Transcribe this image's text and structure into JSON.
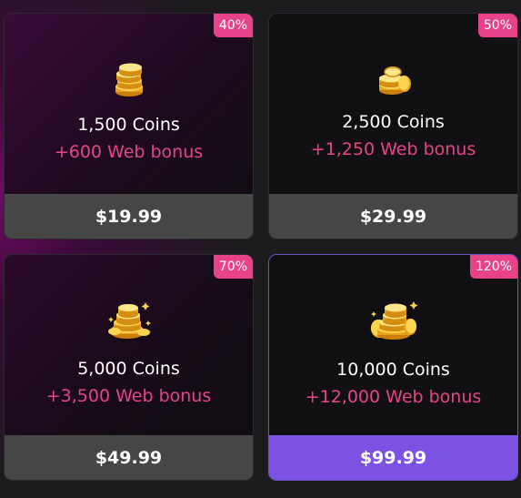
{
  "colors": {
    "accent_pink": "#e8438a",
    "price_bar": "#464646",
    "price_bar_selected": "#7b52e3",
    "selected_border": "#6a55c9"
  },
  "packages": [
    {
      "discount": "40%",
      "coins": "1,500 Coins",
      "bonus": "+600 Web bonus",
      "price": "$19.99",
      "icon": "coin-stack-icon"
    },
    {
      "discount": "50%",
      "coins": "2,500 Coins",
      "bonus": "+1,250 Web bonus",
      "price": "$29.99",
      "icon": "coin-stack-icon"
    },
    {
      "discount": "70%",
      "coins": "5,000 Coins",
      "bonus": "+3,500 Web bonus",
      "price": "$49.99",
      "icon": "coin-pile-icon"
    },
    {
      "discount": "120%",
      "coins": "10,000 Coins",
      "bonus": "+12,000 Web bonus",
      "price": "$99.99",
      "icon": "coin-heap-icon",
      "selected": true
    }
  ]
}
